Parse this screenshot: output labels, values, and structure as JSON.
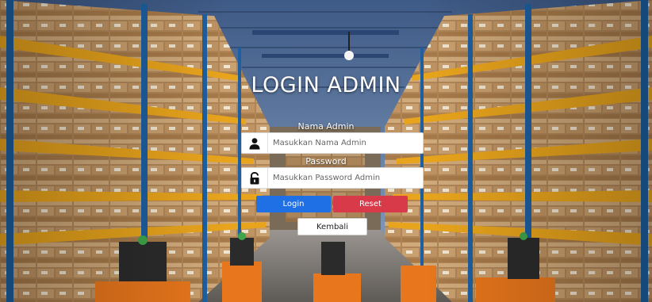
{
  "page": {
    "title": "LOGIN ADMIN"
  },
  "form": {
    "username": {
      "label": "Nama Admin",
      "placeholder": "Masukkan Nama Admin",
      "icon": "user-icon"
    },
    "password": {
      "label": "Password",
      "placeholder": "Masukkan Password Admin",
      "icon": "lock-icon"
    },
    "buttons": {
      "login": "Login",
      "reset": "Reset",
      "back": "Kembali"
    }
  },
  "colors": {
    "login_button": "#1f6fe5",
    "reset_button": "#d93a4a",
    "back_button": "#ffffff",
    "rack_frame": "#e8a41c",
    "rack_post": "#1d5fa0"
  },
  "background": {
    "scene": "warehouse-racks-image"
  }
}
